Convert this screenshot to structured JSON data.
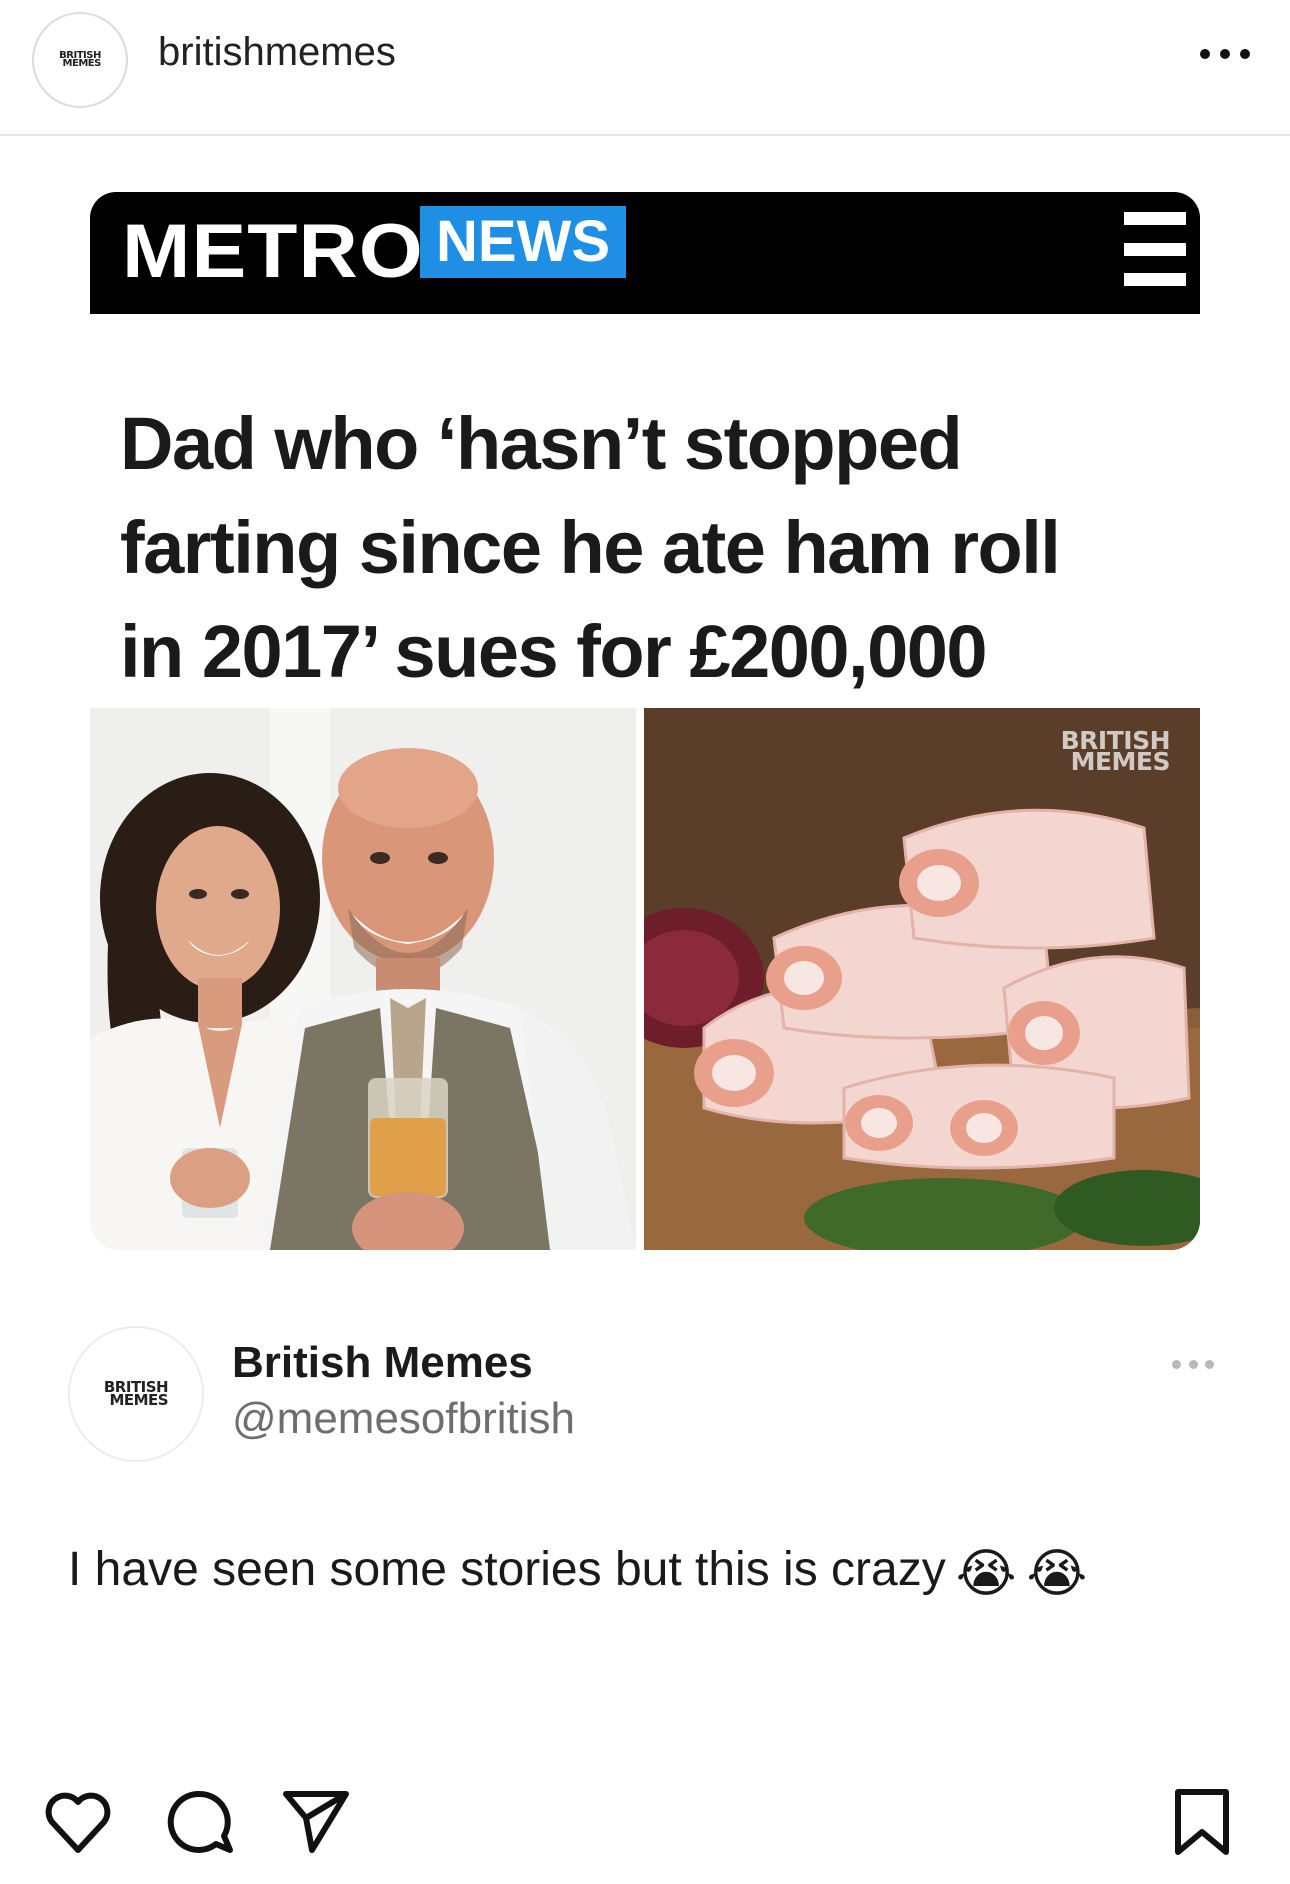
{
  "header": {
    "username": "britishmemes",
    "avatar_logo_line1": "BRITISH",
    "avatar_logo_line2": "MEMES"
  },
  "article": {
    "brand": "METRO",
    "section_badge": "NEWS",
    "headline_lines": [
      "Dad who ‘hasn’t stopped",
      "farting since he ate ham roll",
      "in 2017’ sues for £200,000"
    ],
    "watermark_line1": "BRITISH",
    "watermark_line2": "MEMES",
    "accent_color": "#1f8fe6"
  },
  "tweet": {
    "display_name": "British Memes",
    "handle": "@memesofbritish",
    "avatar_logo_line1": "BRITISH",
    "avatar_logo_line2": "MEMES",
    "text": "I have seen some stories but this is crazy",
    "emojis": [
      "😭",
      "😭"
    ]
  },
  "actions": {
    "icons": [
      "heart-icon",
      "comment-icon",
      "share-icon",
      "bookmark-icon"
    ]
  }
}
